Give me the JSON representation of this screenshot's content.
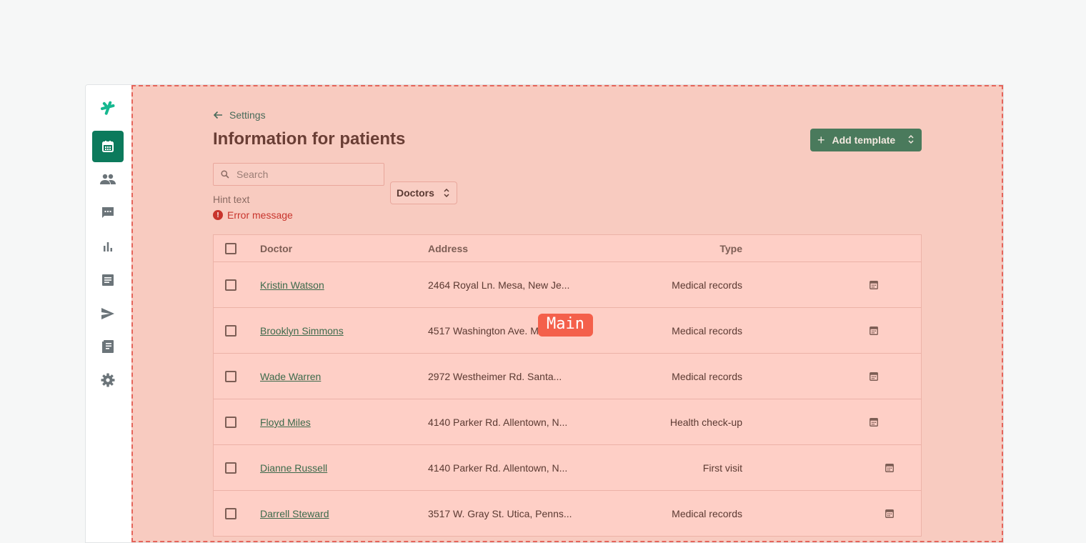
{
  "colors": {
    "brand": "#0c7a5c",
    "main_overlay": "#f8cbc0",
    "overlay_border": "#e5645a",
    "label_bg": "#f4604b",
    "primary_button": "#4a7a5c",
    "error": "#c8342c",
    "link": "#3c6a4b"
  },
  "sidebar": {
    "items": [
      {
        "icon": "logo-icon"
      },
      {
        "icon": "calendar-icon",
        "active": true
      },
      {
        "icon": "users-icon"
      },
      {
        "icon": "chat-icon"
      },
      {
        "icon": "bar-chart-icon"
      },
      {
        "icon": "document-icon"
      },
      {
        "icon": "send-icon"
      },
      {
        "icon": "ledger-icon"
      },
      {
        "icon": "gear-icon"
      }
    ]
  },
  "overlay": {
    "label": "Main"
  },
  "header": {
    "back_label": "Settings",
    "title": "Information for patients",
    "add_button": "Add template"
  },
  "search": {
    "placeholder": "Search",
    "value": ""
  },
  "field": {
    "hint": "Hint text",
    "error": "Error message"
  },
  "filter": {
    "selected": "Doctors"
  },
  "table": {
    "columns": {
      "doctor": "Doctor",
      "address": "Address",
      "type": "Type"
    },
    "rows": [
      {
        "doctor": "Kristin Watson",
        "address": "2464 Royal Ln. Mesa, New Je...",
        "type": "Medical records"
      },
      {
        "doctor": "Brooklyn Simmons",
        "address": "4517 Washington Ave. M",
        "type": "Medical records"
      },
      {
        "doctor": "Wade Warren",
        "address": "2972 Westheimer Rd. Santa...",
        "type": "Medical records"
      },
      {
        "doctor": "Floyd Miles",
        "address": "4140 Parker Rd. Allentown, N...",
        "type": "Health check-up"
      },
      {
        "doctor": "Dianne Russell",
        "address": "4140 Parker Rd. Allentown, N...",
        "type": "First visit"
      },
      {
        "doctor": "Darrell Steward",
        "address": "3517 W. Gray St. Utica, Penns...",
        "type": "Medical records"
      }
    ]
  }
}
